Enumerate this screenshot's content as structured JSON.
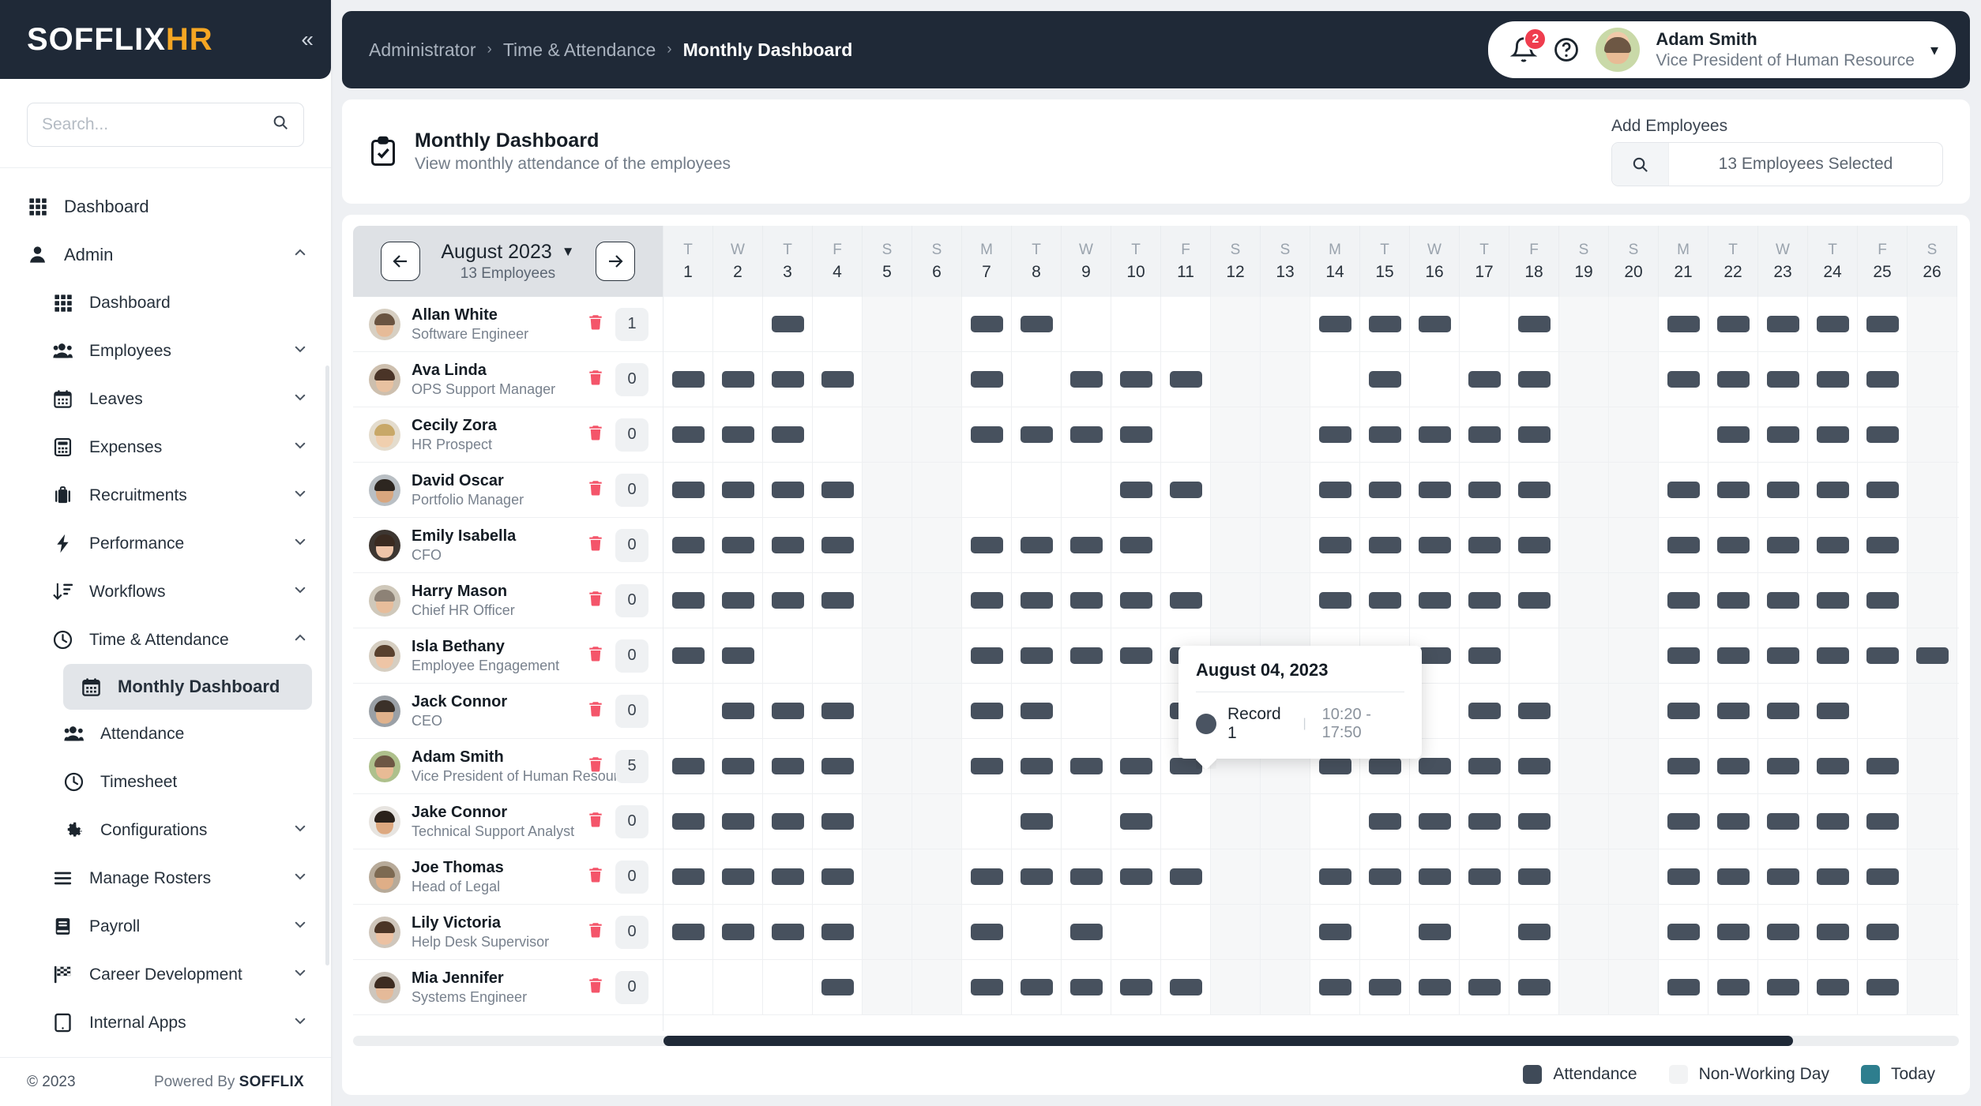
{
  "brand": {
    "name_main": "SOFFLIX",
    "name_accent": "HR",
    "collapse_icon": "chevron-double-left"
  },
  "sidebar": {
    "search_placeholder": "Search...",
    "items": [
      {
        "label": "Dashboard",
        "icon": "grid-icon",
        "level": 0,
        "chevron": ""
      },
      {
        "label": "Admin",
        "icon": "user-icon",
        "level": 0,
        "chevron": "up"
      },
      {
        "label": "Dashboard",
        "icon": "grid-icon",
        "level": 1,
        "chevron": ""
      },
      {
        "label": "Employees",
        "icon": "people-icon",
        "level": 1,
        "chevron": "down"
      },
      {
        "label": "Leaves",
        "icon": "calendar-icon",
        "level": 1,
        "chevron": "down"
      },
      {
        "label": "Expenses",
        "icon": "calculator-icon",
        "level": 1,
        "chevron": "down"
      },
      {
        "label": "Recruitments",
        "icon": "briefcase-icon",
        "level": 1,
        "chevron": "down"
      },
      {
        "label": "Performance",
        "icon": "bolt-icon",
        "level": 1,
        "chevron": "down"
      },
      {
        "label": "Workflows",
        "icon": "sort-icon",
        "level": 1,
        "chevron": "down"
      },
      {
        "label": "Time & Attendance",
        "icon": "clock-icon",
        "level": 1,
        "chevron": "up"
      },
      {
        "label": "Monthly Dashboard",
        "icon": "calendar-days-icon",
        "level": 2,
        "chevron": "",
        "active": true
      },
      {
        "label": "Attendance",
        "icon": "people-icon",
        "level": 2,
        "chevron": ""
      },
      {
        "label": "Timesheet",
        "icon": "clock-icon",
        "level": 2,
        "chevron": ""
      },
      {
        "label": "Configurations",
        "icon": "gear-icon",
        "level": 2,
        "chevron": "down"
      },
      {
        "label": "Manage Rosters",
        "icon": "menu-icon",
        "level": 1,
        "chevron": "down"
      },
      {
        "label": "Payroll",
        "icon": "book-icon",
        "level": 1,
        "chevron": "down"
      },
      {
        "label": "Career Development",
        "icon": "flag-icon",
        "level": 1,
        "chevron": "down"
      },
      {
        "label": "Internal Apps",
        "icon": "tablet-icon",
        "level": 1,
        "chevron": "down"
      }
    ],
    "footer": {
      "copyright": "© 2023",
      "powered_prefix": "Powered By",
      "powered_brand": "SOFFLIX"
    }
  },
  "topbar": {
    "breadcrumb": [
      "Administrator",
      "Time & Attendance",
      "Monthly Dashboard"
    ],
    "notification_count": "2",
    "help_icon": "question-circle-icon",
    "user": {
      "name": "Adam Smith",
      "role": "Vice President of Human Resource"
    }
  },
  "page": {
    "title": "Monthly Dashboard",
    "subtitle": "View monthly attendance of the employees",
    "icon": "clipboard-check-icon",
    "add_employees_label": "Add Employees",
    "employees_selected": "13 Employees Selected",
    "search_icon": "search-icon"
  },
  "calendar": {
    "month_label": "August 2023",
    "employee_count": "13 Employees",
    "prev_icon": "arrow-left-icon",
    "next_icon": "arrow-right-icon",
    "days": [
      {
        "dow": "T",
        "num": "1"
      },
      {
        "dow": "W",
        "num": "2"
      },
      {
        "dow": "T",
        "num": "3"
      },
      {
        "dow": "F",
        "num": "4"
      },
      {
        "dow": "S",
        "num": "5",
        "weekend": true
      },
      {
        "dow": "S",
        "num": "6",
        "weekend": true
      },
      {
        "dow": "M",
        "num": "7"
      },
      {
        "dow": "T",
        "num": "8"
      },
      {
        "dow": "W",
        "num": "9"
      },
      {
        "dow": "T",
        "num": "10"
      },
      {
        "dow": "F",
        "num": "11"
      },
      {
        "dow": "S",
        "num": "12",
        "weekend": true
      },
      {
        "dow": "S",
        "num": "13",
        "weekend": true
      },
      {
        "dow": "M",
        "num": "14"
      },
      {
        "dow": "T",
        "num": "15"
      },
      {
        "dow": "W",
        "num": "16"
      },
      {
        "dow": "T",
        "num": "17"
      },
      {
        "dow": "F",
        "num": "18"
      },
      {
        "dow": "S",
        "num": "19",
        "weekend": true
      },
      {
        "dow": "S",
        "num": "20",
        "weekend": true
      },
      {
        "dow": "M",
        "num": "21"
      },
      {
        "dow": "T",
        "num": "22"
      },
      {
        "dow": "W",
        "num": "23"
      },
      {
        "dow": "T",
        "num": "24"
      },
      {
        "dow": "F",
        "num": "25"
      },
      {
        "dow": "S",
        "num": "26",
        "weekend": true
      }
    ],
    "employees": [
      {
        "name": "Allan White",
        "role": "Software Engineer",
        "count": "1",
        "hair": "#6a5441",
        "skin": "#e6bb98",
        "bg": "#d7cfc2",
        "attendance": [
          0,
          0,
          1,
          0,
          0,
          0,
          1,
          1,
          0,
          0,
          0,
          0,
          0,
          1,
          1,
          1,
          0,
          1,
          0,
          0,
          1,
          1,
          1,
          1,
          1,
          0
        ]
      },
      {
        "name": "Ava Linda",
        "role": "OPS Support Manager",
        "count": "0",
        "hair": "#4a3427",
        "skin": "#e8c1a0",
        "bg": "#cdbfae",
        "attendance": [
          1,
          1,
          1,
          1,
          0,
          0,
          1,
          0,
          1,
          1,
          1,
          0,
          0,
          0,
          1,
          0,
          1,
          1,
          0,
          0,
          1,
          1,
          1,
          1,
          1,
          0
        ]
      },
      {
        "name": "Cecily Zora",
        "role": "HR Prospect",
        "count": "0",
        "hair": "#c8a868",
        "skin": "#f0cfae",
        "bg": "#e4dccd",
        "attendance": [
          1,
          1,
          1,
          0,
          0,
          0,
          1,
          1,
          1,
          1,
          0,
          0,
          0,
          1,
          1,
          1,
          1,
          1,
          0,
          0,
          0,
          1,
          1,
          1,
          1,
          0
        ]
      },
      {
        "name": "David Oscar",
        "role": "Portfolio Manager",
        "count": "0",
        "hair": "#2d2620",
        "skin": "#d8a67e",
        "bg": "#b9bfc4",
        "attendance": [
          1,
          1,
          1,
          1,
          0,
          0,
          0,
          0,
          0,
          1,
          1,
          0,
          0,
          1,
          1,
          1,
          1,
          1,
          0,
          0,
          1,
          1,
          1,
          1,
          1,
          0
        ]
      },
      {
        "name": "Emily Isabella",
        "role": "CFO",
        "count": "0",
        "hair": "#3a2a20",
        "skin": "#eec4a8",
        "bg": "#3d3631",
        "attendance": [
          1,
          1,
          1,
          1,
          0,
          0,
          1,
          1,
          1,
          1,
          0,
          0,
          0,
          1,
          1,
          1,
          1,
          1,
          0,
          0,
          1,
          1,
          1,
          1,
          1,
          0
        ]
      },
      {
        "name": "Harry Mason",
        "role": "Chief HR Officer",
        "count": "0",
        "hair": "#8d8276",
        "skin": "#e7bd9b",
        "bg": "#cfc8ba",
        "attendance": [
          1,
          1,
          1,
          1,
          0,
          0,
          1,
          1,
          1,
          1,
          1,
          0,
          0,
          1,
          1,
          1,
          1,
          1,
          0,
          0,
          1,
          1,
          1,
          1,
          1,
          0
        ]
      },
      {
        "name": "Isla Bethany",
        "role": "Employee Engagement",
        "count": "0",
        "hair": "#59412e",
        "skin": "#eec5a6",
        "bg": "#d6cec1",
        "attendance": [
          1,
          1,
          0,
          0,
          0,
          0,
          1,
          1,
          1,
          1,
          1,
          0,
          0,
          1,
          1,
          1,
          1,
          0,
          0,
          0,
          1,
          1,
          1,
          1,
          1,
          1
        ]
      },
      {
        "name": "Jack Connor",
        "role": "CEO",
        "count": "0",
        "hair": "#3b3129",
        "skin": "#e0b28c",
        "bg": "#9aa0a6",
        "attendance": [
          0,
          1,
          1,
          1,
          0,
          0,
          1,
          1,
          0,
          0,
          1,
          0,
          0,
          1,
          1,
          0,
          1,
          1,
          0,
          0,
          1,
          1,
          1,
          1,
          0,
          0
        ]
      },
      {
        "name": "Adam Smith",
        "role": "Vice President of Human Resource",
        "count": "5",
        "hair": "#6d5744",
        "skin": "#e8bb95",
        "bg": "#aec08c",
        "attendance": [
          1,
          1,
          1,
          1,
          0,
          0,
          1,
          1,
          1,
          1,
          1,
          0,
          0,
          1,
          1,
          1,
          1,
          1,
          0,
          0,
          1,
          1,
          1,
          1,
          1,
          0
        ]
      },
      {
        "name": "Jake Connor",
        "role": "Technical Support Analyst",
        "count": "0",
        "hair": "#2a211b",
        "skin": "#dda87f",
        "bg": "#e7e4e0",
        "attendance": [
          1,
          1,
          1,
          1,
          0,
          0,
          0,
          1,
          0,
          1,
          0,
          0,
          0,
          0,
          1,
          1,
          1,
          1,
          0,
          0,
          1,
          1,
          1,
          1,
          1,
          0
        ]
      },
      {
        "name": "Joe Thomas",
        "role": "Head of Legal",
        "count": "0",
        "hair": "#7d6a52",
        "skin": "#dfae87",
        "bg": "#b7aa99",
        "attendance": [
          1,
          1,
          1,
          1,
          0,
          0,
          1,
          1,
          1,
          1,
          1,
          0,
          0,
          1,
          1,
          1,
          1,
          1,
          0,
          0,
          1,
          1,
          1,
          1,
          1,
          0
        ]
      },
      {
        "name": "Lily Victoria",
        "role": "Help Desk Supervisor",
        "count": "0",
        "hair": "#4b3526",
        "skin": "#ecc1a2",
        "bg": "#cfc6bb",
        "attendance": [
          1,
          1,
          1,
          1,
          0,
          0,
          1,
          0,
          1,
          0,
          0,
          0,
          0,
          1,
          0,
          1,
          0,
          1,
          0,
          0,
          1,
          1,
          1,
          1,
          1,
          0
        ]
      },
      {
        "name": "Mia Jennifer",
        "role": "Systems Engineer",
        "count": "0",
        "hair": "#3d2c21",
        "skin": "#e5ba99",
        "bg": "#cdc6bd",
        "attendance": [
          0,
          0,
          0,
          1,
          0,
          0,
          1,
          1,
          1,
          1,
          1,
          0,
          0,
          1,
          1,
          1,
          1,
          1,
          0,
          0,
          1,
          1,
          1,
          1,
          1,
          0
        ]
      }
    ]
  },
  "tooltip": {
    "date": "August 04, 2023",
    "record_label": "Record 1",
    "separator": "|",
    "time_range": "10:20 - 17:50"
  },
  "legend": [
    {
      "label": "Attendance",
      "color": "#3f4a58"
    },
    {
      "label": "Non-Working Day",
      "color": "#f2f3f4"
    },
    {
      "label": "Today",
      "color": "#2e7e8e"
    }
  ],
  "colors": {
    "accent": "#f5a623",
    "dark": "#1f2937",
    "attendance": "#47515e",
    "danger": "#ef3d4e"
  }
}
